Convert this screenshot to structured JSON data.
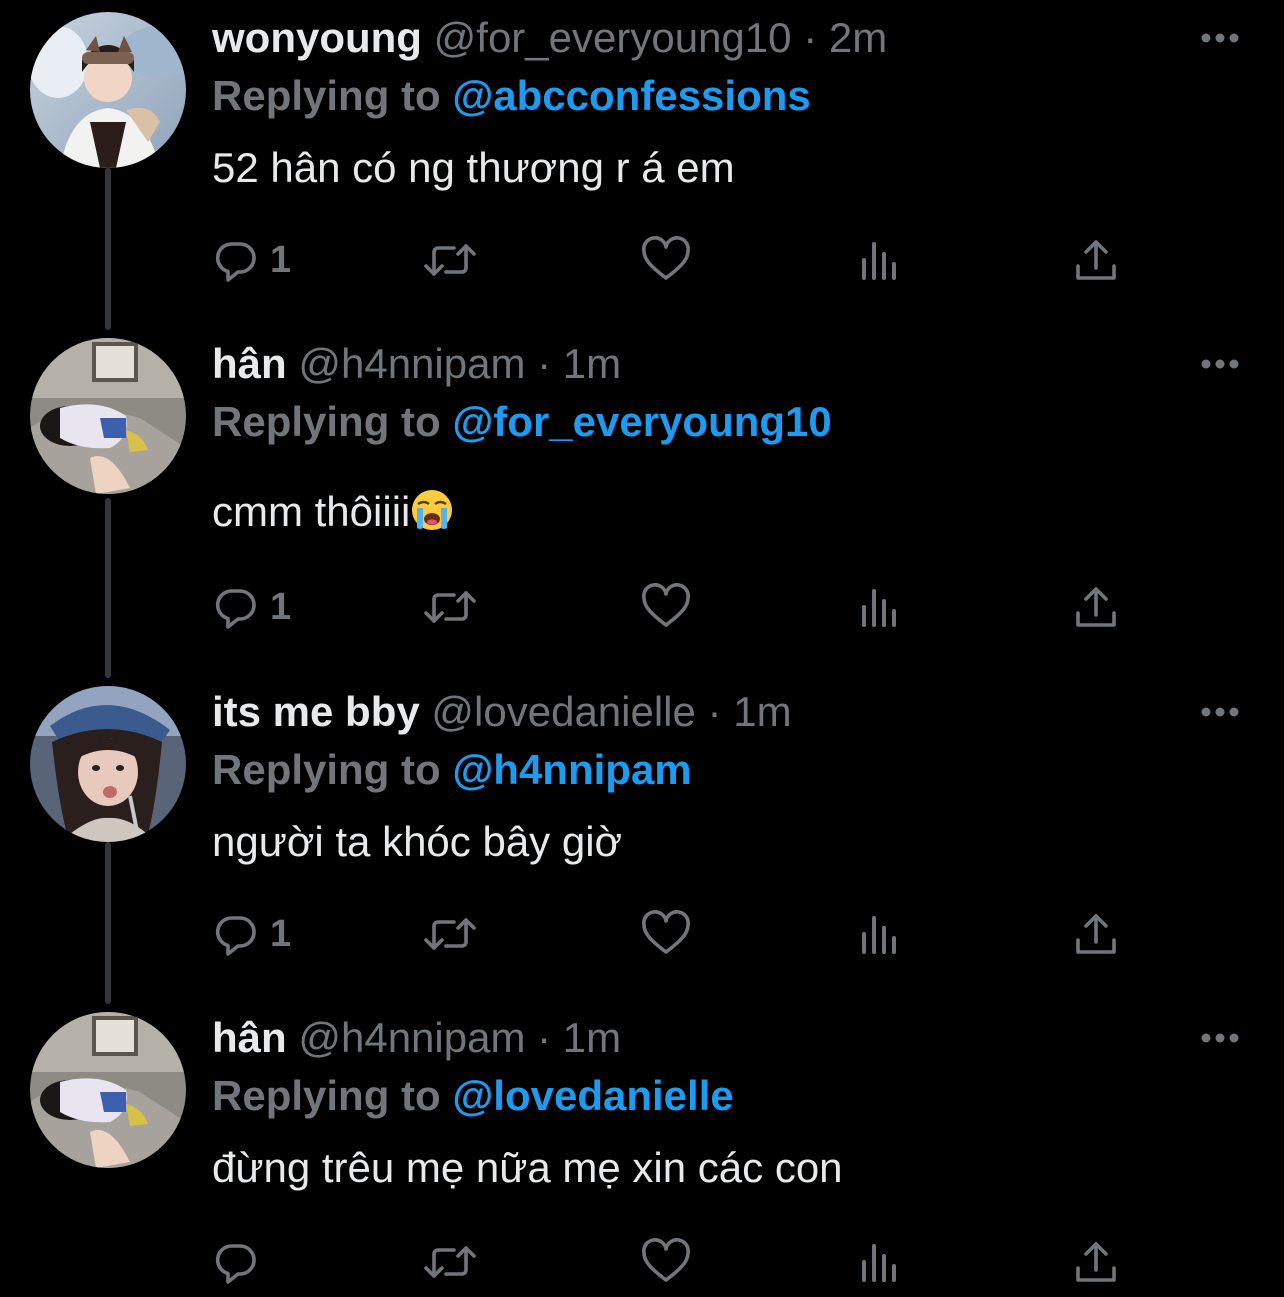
{
  "colors": {
    "background": "#000000",
    "text_primary": "#e7e9ea",
    "text_secondary": "#71767b",
    "accent": "#1d9bf0",
    "thread_line": "#333639"
  },
  "tweets": [
    {
      "display_name": "wonyoung",
      "handle": "@for_everyoung10",
      "separator": "·",
      "time": "2m",
      "replying_label": "Replying to",
      "replying_to": "@abcconfessions",
      "text": "52 hân có ng thương r á em",
      "reply_count": "1",
      "icons": [
        "reply-icon",
        "retweet-icon",
        "like-icon",
        "analytics-icon",
        "share-icon",
        "more-options-icon"
      ]
    },
    {
      "display_name": "hân",
      "handle": "@h4nnipam",
      "separator": "·",
      "time": "1m",
      "replying_label": "Replying to",
      "replying_to": "@for_everyoung10",
      "text": "cmm thôiiii",
      "emoji": "loudly-crying-face-emoji",
      "reply_count": "1",
      "icons": [
        "reply-icon",
        "retweet-icon",
        "like-icon",
        "analytics-icon",
        "share-icon",
        "more-options-icon"
      ]
    },
    {
      "display_name": "its me bby",
      "handle": "@lovedanielle",
      "separator": "·",
      "time": "1m",
      "replying_label": "Replying to",
      "replying_to": "@h4nnipam",
      "text": "người ta khóc bây giờ",
      "reply_count": "1",
      "icons": [
        "reply-icon",
        "retweet-icon",
        "like-icon",
        "analytics-icon",
        "share-icon",
        "more-options-icon"
      ]
    },
    {
      "display_name": "hân",
      "handle": "@h4nnipam",
      "separator": "·",
      "time": "1m",
      "replying_label": "Replying to",
      "replying_to": "@lovedanielle",
      "text": "đừng trêu mẹ nữa mẹ xin các con",
      "reply_count": "",
      "icons": [
        "reply-icon",
        "retweet-icon",
        "like-icon",
        "analytics-icon",
        "share-icon",
        "more-options-icon"
      ]
    }
  ]
}
